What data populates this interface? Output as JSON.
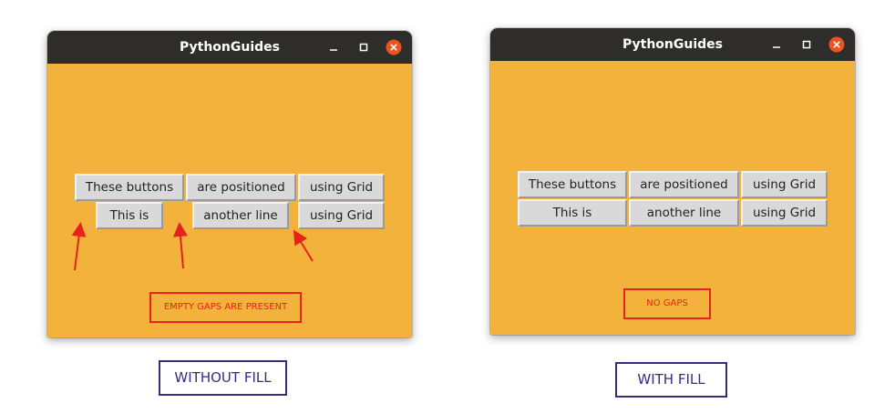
{
  "left_window": {
    "title": "PythonGuides",
    "row1": [
      "These buttons",
      "are positioned",
      "using Grid"
    ],
    "row2": [
      "This is",
      "another line",
      "using Grid"
    ],
    "label": "EMPTY GAPS ARE PRESENT",
    "caption": "WITHOUT FILL"
  },
  "right_window": {
    "title": "PythonGuides",
    "row1": [
      "These buttons",
      "are positioned",
      "using Grid"
    ],
    "row2": [
      "This is",
      "another line",
      "using Grid"
    ],
    "label": "NO GAPS",
    "caption": "WITH FILL"
  },
  "colors": {
    "window_bg": "#f2b23c",
    "titlebar": "#2f2d2b",
    "button_bg": "#d9d9d9",
    "accent_red": "#e8211b",
    "caption_border": "#3a2a80",
    "close_button": "#e95420"
  },
  "icons": [
    "minimize-icon",
    "maximize-icon",
    "close-icon",
    "arrow-icon"
  ]
}
